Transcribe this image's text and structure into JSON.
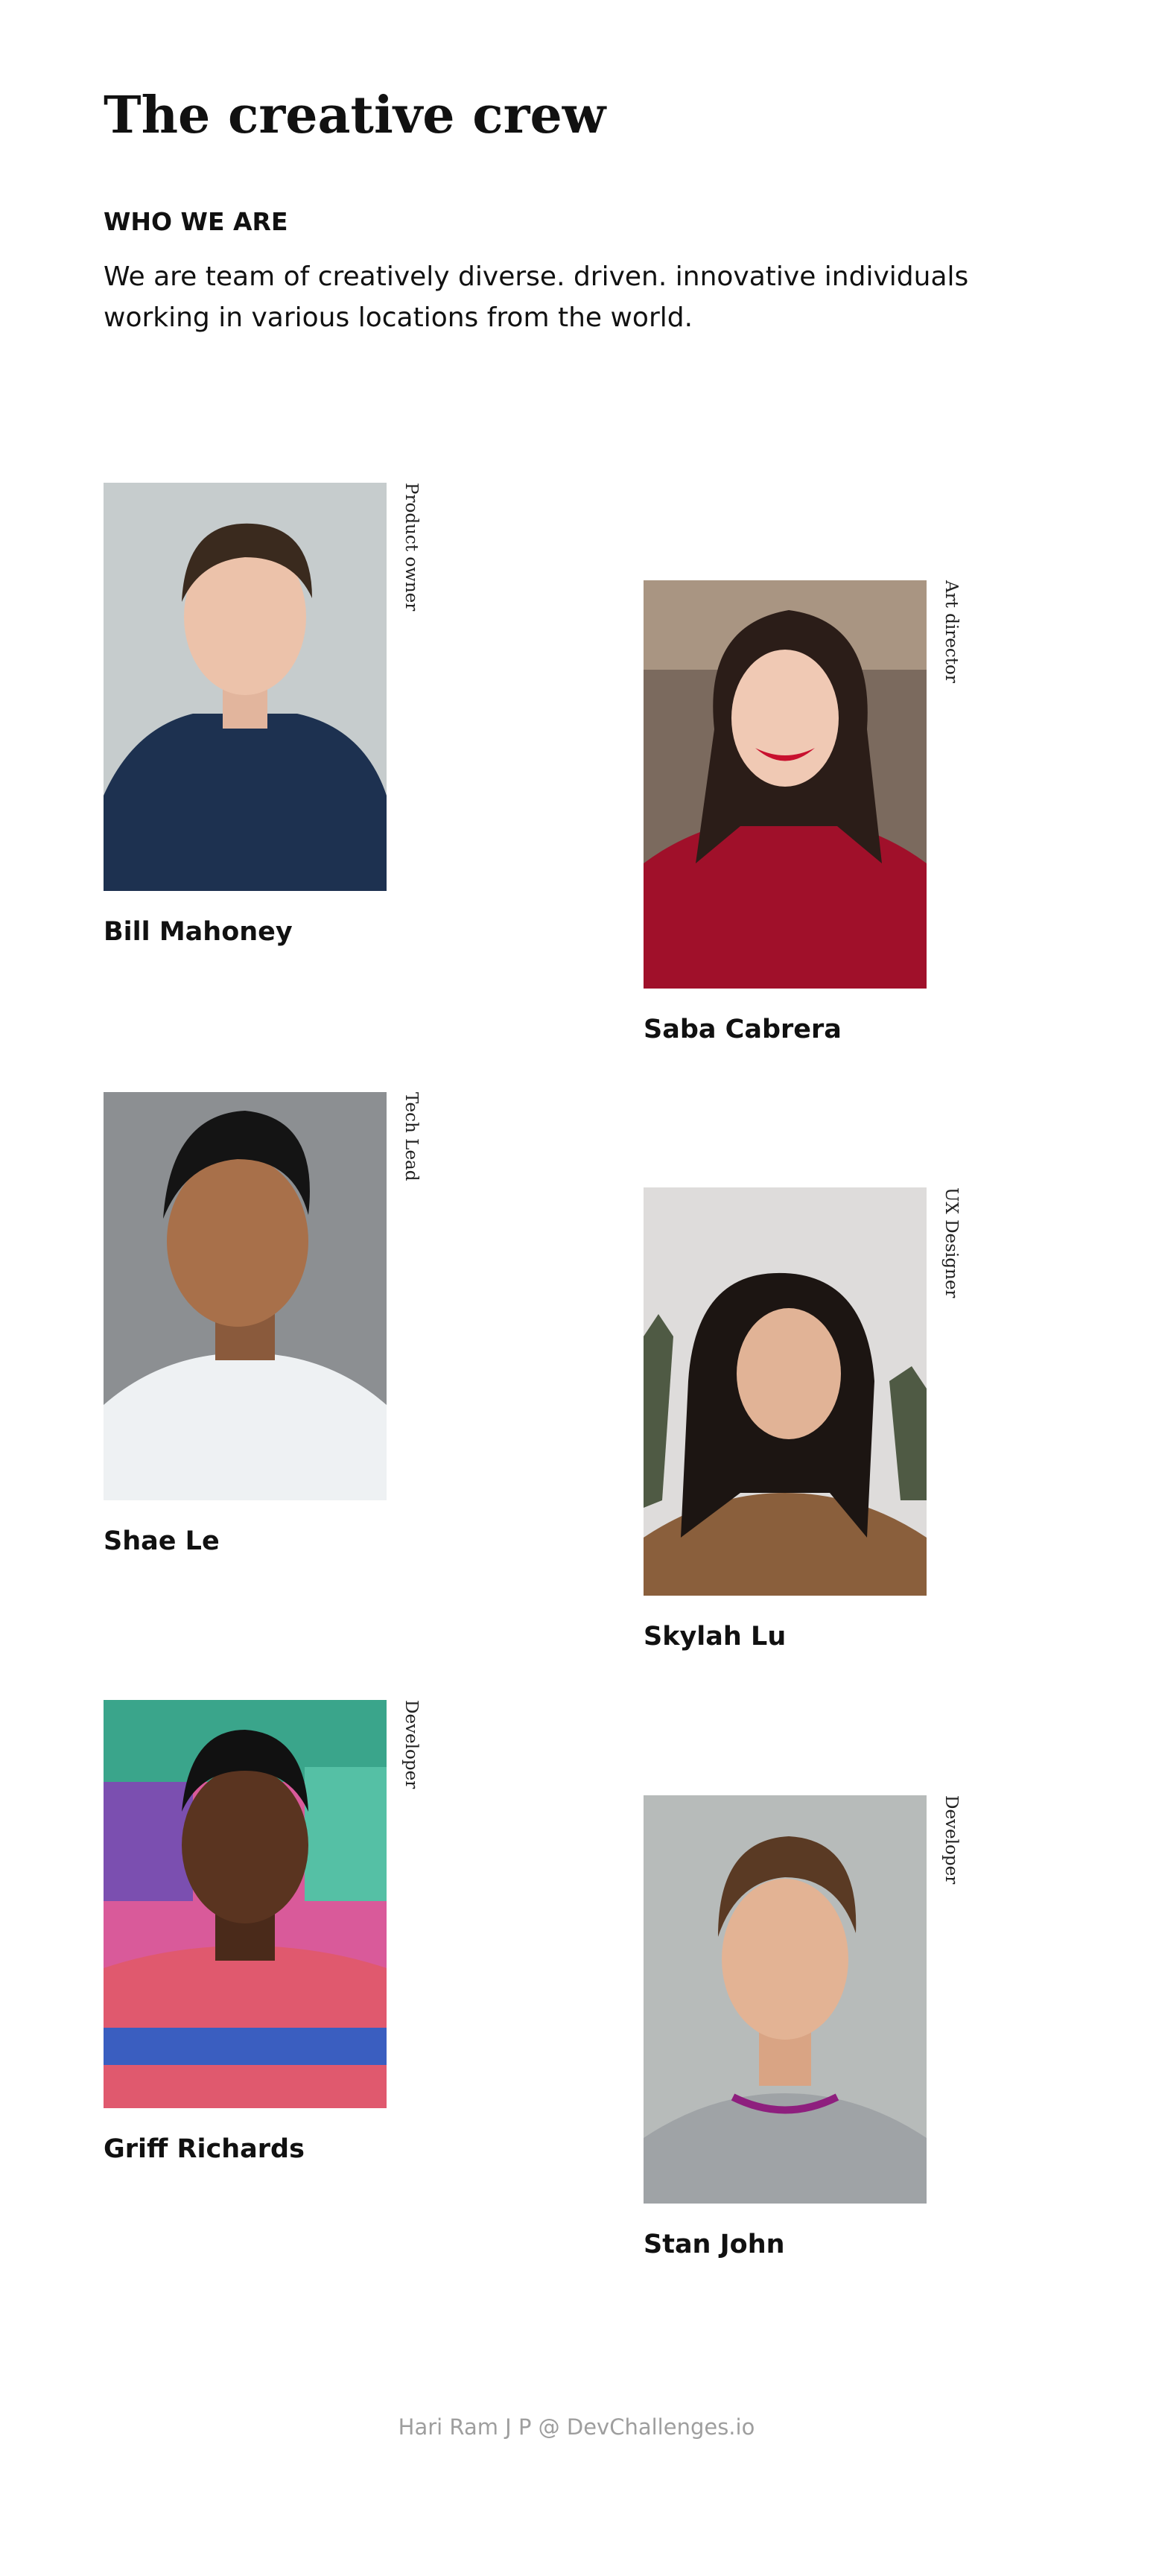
{
  "header": {
    "title": "The creative crew",
    "section_heading": "WHO WE ARE",
    "intro": "We are team of creatively diverse. driven. innovative individuals working in various locations from the world."
  },
  "team": [
    {
      "name": "Bill Mahoney",
      "role": "Product owner"
    },
    {
      "name": "Saba Cabrera",
      "role": "Art director"
    },
    {
      "name": "Shae Le",
      "role": "Tech Lead"
    },
    {
      "name": "Skylah Lu",
      "role": "UX Designer"
    },
    {
      "name": "Griff Richards",
      "role": "Developer"
    },
    {
      "name": "Stan John",
      "role": "Developer"
    }
  ],
  "footer": {
    "credit": "Hari Ram J P @ DevChallenges.io"
  },
  "colors": {
    "text": "#111111",
    "footer": "#9e9e9e",
    "background": "#ffffff"
  }
}
